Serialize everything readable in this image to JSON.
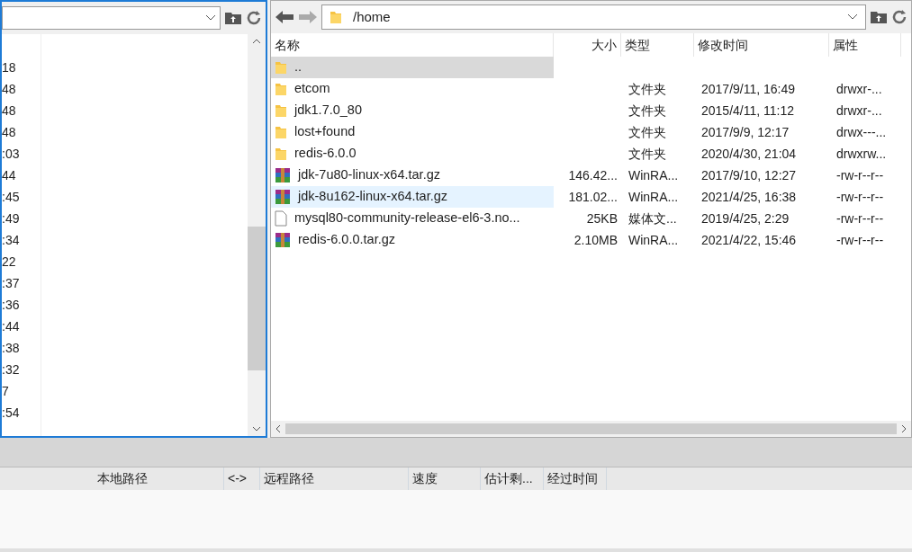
{
  "local_panel": {
    "times": [
      "18",
      "48",
      "48",
      "48",
      ":03",
      "44",
      ":45",
      ":49",
      ":34",
      "22",
      ":37",
      ":36",
      ":44",
      ":38",
      ":32",
      "7",
      ":54"
    ]
  },
  "remote_panel": {
    "path": "/home",
    "columns": [
      "名称",
      "大小",
      "类型",
      "修改时间",
      "属性"
    ],
    "rows": [
      {
        "kind": "folder",
        "name": "..",
        "size": "",
        "type": "",
        "modified": "",
        "attrs": "",
        "selected": true,
        "hovered": false
      },
      {
        "kind": "folder",
        "name": "etcom",
        "size": "",
        "type": "文件夹",
        "modified": "2017/9/11, 16:49",
        "attrs": "drwxr-...",
        "selected": false,
        "hovered": false
      },
      {
        "kind": "folder",
        "name": "jdk1.7.0_80",
        "size": "",
        "type": "文件夹",
        "modified": "2015/4/11, 11:12",
        "attrs": "drwxr-...",
        "selected": false,
        "hovered": false
      },
      {
        "kind": "folder",
        "name": "lost+found",
        "size": "",
        "type": "文件夹",
        "modified": "2017/9/9, 12:17",
        "attrs": "drwx---...",
        "selected": false,
        "hovered": false
      },
      {
        "kind": "folder",
        "name": "redis-6.0.0",
        "size": "",
        "type": "文件夹",
        "modified": "2020/4/30, 21:04",
        "attrs": "drwxrw...",
        "selected": false,
        "hovered": false
      },
      {
        "kind": "archive",
        "name": "jdk-7u80-linux-x64.tar.gz",
        "size": "146.42...",
        "type": "WinRA...",
        "modified": "2017/9/10, 12:27",
        "attrs": "-rw-r--r--",
        "selected": false,
        "hovered": false
      },
      {
        "kind": "archive",
        "name": "jdk-8u162-linux-x64.tar.gz",
        "size": "181.02...",
        "type": "WinRA...",
        "modified": "2021/4/25, 16:38",
        "attrs": "-rw-r--r--",
        "selected": false,
        "hovered": true
      },
      {
        "kind": "file",
        "name": "mysql80-community-release-el6-3.no...",
        "size": "25KB",
        "type": "媒体文...",
        "modified": "2019/4/25, 2:29",
        "attrs": "-rw-r--r--",
        "selected": false,
        "hovered": false
      },
      {
        "kind": "archive",
        "name": "redis-6.0.0.tar.gz",
        "size": "2.10MB",
        "type": "WinRA...",
        "modified": "2021/4/22, 15:46",
        "attrs": "-rw-r--r--",
        "selected": false,
        "hovered": false
      }
    ]
  },
  "queue": {
    "columns": [
      "本地路径",
      "<->",
      "远程路径",
      "速度",
      "估计剩...",
      "经过时间"
    ]
  }
}
